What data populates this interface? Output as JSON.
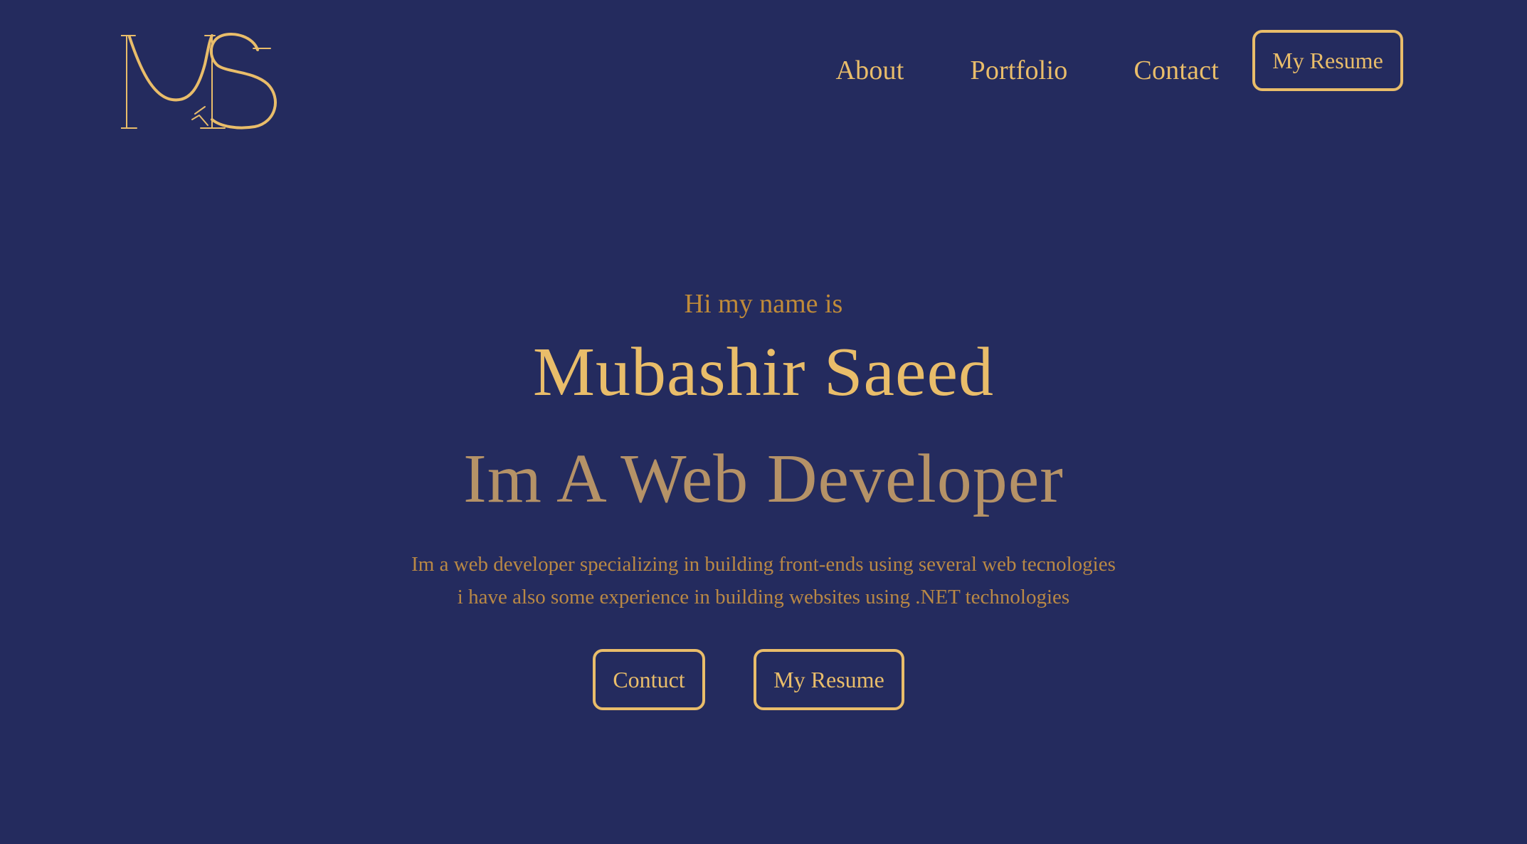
{
  "header": {
    "nav": [
      {
        "label": "About"
      },
      {
        "label": "Portfolio"
      },
      {
        "label": "Contact"
      }
    ],
    "resume_button": "My Resume"
  },
  "hero": {
    "intro": "Hi my name is",
    "name": "Mubashir Saeed",
    "role": "Im A Web Developer",
    "description": [
      "Im a web developer specializing in building front-ends using several web tecnologies",
      "i have also some experience in building websites using .NET technologies"
    ],
    "contact_button": "Contuct",
    "resume_button": "My Resume"
  },
  "colors": {
    "background": "#242b5e",
    "accent": "#e9bd6a",
    "muted": "#b59267"
  }
}
